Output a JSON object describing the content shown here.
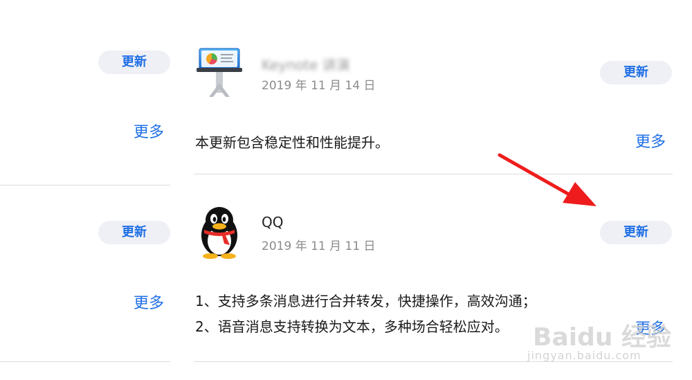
{
  "left_panel": {
    "rows": [
      {
        "update_label": "更新",
        "more_label": "更多"
      },
      {
        "update_label": "更新",
        "more_label": "更多"
      }
    ]
  },
  "apps": [
    {
      "icon": "keynote-icon",
      "name": "Keynote 讲演",
      "name_blurred": true,
      "date": "2019 年 11 月 14 日",
      "update_label": "更新",
      "notes": [
        "本更新包含稳定性和性能提升。"
      ],
      "more_label": "更多"
    },
    {
      "icon": "qq-penguin-icon",
      "name": "QQ",
      "name_blurred": false,
      "date": "2019 年 11 月 11 日",
      "update_label": "更新",
      "notes": [
        "1、支持多条消息进行合并转发，快捷操作，高效沟通；",
        "2、语音消息支持转换为文本，多种场合轻松应对。"
      ],
      "more_label": "更多"
    }
  ],
  "annotation": {
    "type": "red-arrow",
    "color": "#ee1c1c",
    "target": "qq-update-button"
  },
  "watermark": {
    "brand": "Baidu 经验",
    "url": "jingyan.baidu.com"
  },
  "colors": {
    "accent": "#1f6fe6",
    "button_bg": "#eef0f5",
    "divider": "#dcdcdc",
    "arrow": "#ee1c1c"
  }
}
